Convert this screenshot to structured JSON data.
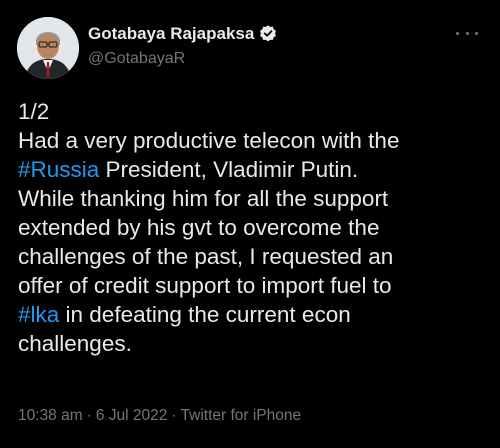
{
  "author": {
    "display_name": "Gotabaya Rajapaksa",
    "handle": "@GotabayaR",
    "verified_icon": "verified-badge-icon",
    "avatar": "profile-photo"
  },
  "menu": {
    "more_icon": "more-horizontal-icon"
  },
  "tweet": {
    "line1": "1/2",
    "line2": "Had a very productive telecon with the",
    "line3_hashtag": "#Russia",
    "line3_rest": " President, Vladimir Putin.",
    "line4": "While thanking him for all the support",
    "line5": "extended by his gvt to overcome the",
    "line6": "challenges of the past, I requested an",
    "line7": "offer of credit support to import fuel to",
    "line8_hashtag": "#lka",
    "line8_rest": " in defeating the current econ",
    "line9": "challenges."
  },
  "meta": {
    "time": "10:38 am",
    "separator": "·",
    "date": "6 Jul 2022",
    "source": "Twitter for iPhone"
  },
  "colors": {
    "background": "#000000",
    "text": "#e7e9ea",
    "secondary": "#71767b",
    "link": "#1d9bf0"
  }
}
